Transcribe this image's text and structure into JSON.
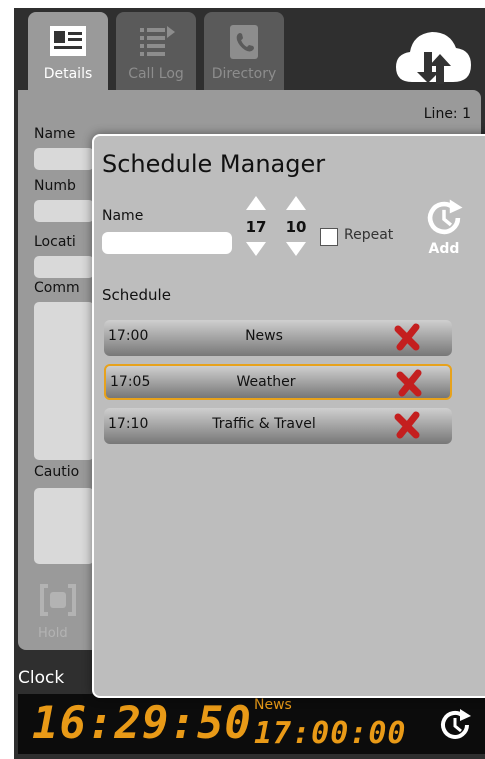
{
  "tabs": [
    {
      "label": "Details",
      "icon": "contact-card-icon",
      "active": true
    },
    {
      "label": "Call Log",
      "icon": "list-icon",
      "active": false
    },
    {
      "label": "Directory",
      "icon": "phone-book-icon",
      "active": false
    }
  ],
  "cloud_button_icon": "cloud-sync-icon",
  "details": {
    "line_label": "Line: 1",
    "labels": [
      "Name",
      "Numb",
      "Locati",
      "Comm",
      "Cautio"
    ],
    "hold_label": "Hold"
  },
  "clock": {
    "label": "Clock",
    "time": "16:29:50",
    "next_item_name": "News",
    "next_item_time": "17:00:00"
  },
  "modal": {
    "title": "Schedule Manager",
    "name_label": "Name",
    "name_value": "",
    "hour": "17",
    "minute": "10",
    "repeat_label": "Repeat",
    "repeat_checked": false,
    "add_label": "Add",
    "schedule_label": "Schedule",
    "items": [
      {
        "time": "17:00",
        "name": "News",
        "selected": false
      },
      {
        "time": "17:05",
        "name": "Weather",
        "selected": true
      },
      {
        "time": "17:10",
        "name": "Traffic & Travel",
        "selected": false
      }
    ]
  },
  "colors": {
    "accent_orange": "#e99a17",
    "delete_red": "#c41f1f",
    "panel_grey": "#9a9a9a",
    "dark_bg": "#2f2f2f"
  }
}
